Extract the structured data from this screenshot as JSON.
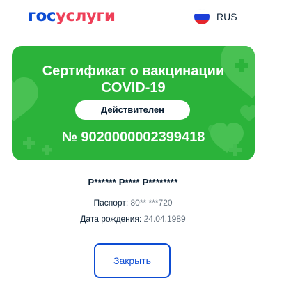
{
  "header": {
    "logo_part1": "гос",
    "logo_part2": "услуги",
    "language": "RUS",
    "flag_colors": [
      "#ffffff",
      "#1c3fd8",
      "#e5262d"
    ]
  },
  "certificate": {
    "title": "Сертификат о вакцинации COVID-19",
    "status": "Действителен",
    "number": "№ 9020000002399418",
    "card_color": "#2bb33a"
  },
  "holder": {
    "name": "Р****** Р**** Р********",
    "passport_label": "Паспорт:",
    "passport_value": "80** ***720",
    "birth_label": "Дата рождения:",
    "birth_value": "24.04.1989"
  },
  "actions": {
    "close_label": "Закрыть"
  },
  "colors": {
    "brand_blue": "#0d4cd3",
    "brand_red": "#ee3f58",
    "text_dark": "#0b1f33",
    "text_muted": "#66727f"
  }
}
